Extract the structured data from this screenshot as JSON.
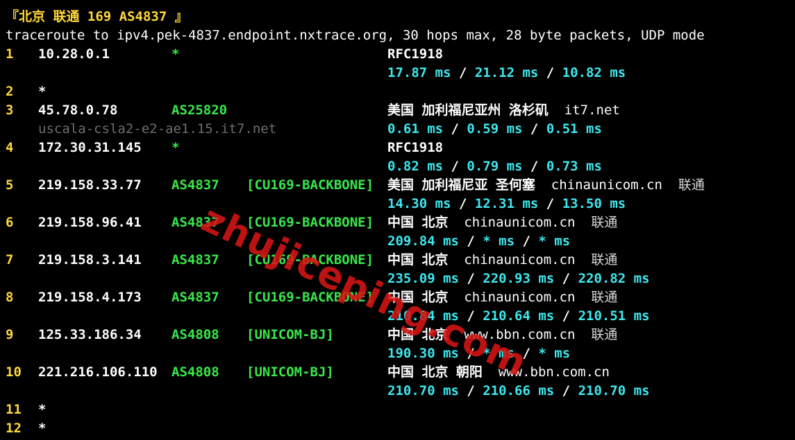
{
  "header": "『北京 联通 169 AS4837 』",
  "command": "traceroute to ipv4.pek-4837.endpoint.nxtrace.org, 30 hops max, 28 byte packets, UDP mode",
  "hops": [
    {
      "hop": "1",
      "ip": "10.28.0.1",
      "asn": "*",
      "tag": "",
      "geo": "RFC1918",
      "domain": "",
      "isp": "",
      "rtt": [
        "17.87 ms",
        "21.12 ms",
        "10.82 ms"
      ],
      "rdns": ""
    },
    {
      "hop": "2",
      "ip": "*",
      "asn": "",
      "tag": "",
      "geo": "",
      "domain": "",
      "isp": "",
      "rtt": [],
      "rdns": ""
    },
    {
      "hop": "3",
      "ip": "45.78.0.78",
      "asn": "AS25820",
      "tag": "",
      "geo": "美国 加利福尼亚州 洛杉矶",
      "domain": "it7.net",
      "isp": "",
      "rtt": [
        "0.61 ms",
        "0.59 ms",
        "0.51 ms"
      ],
      "rdns": "uscala-csla2-e2-ae1.15.it7.net"
    },
    {
      "hop": "4",
      "ip": "172.30.31.145",
      "asn": "*",
      "tag": "",
      "geo": "RFC1918",
      "domain": "",
      "isp": "",
      "rtt": [
        "0.82 ms",
        "0.79 ms",
        "0.73 ms"
      ],
      "rdns": ""
    },
    {
      "hop": "5",
      "ip": "219.158.33.77",
      "asn": "AS4837",
      "tag": "[CU169-BACKBONE]",
      "geo": "美国 加利福尼亚 圣何塞",
      "domain": "chinaunicom.cn",
      "isp": "联通",
      "rtt": [
        "14.30 ms",
        "12.31 ms",
        "13.50 ms"
      ],
      "rdns": ""
    },
    {
      "hop": "6",
      "ip": "219.158.96.41",
      "asn": "AS4837",
      "tag": "[CU169-BACKBONE]",
      "geo": "中国 北京",
      "domain": "chinaunicom.cn",
      "isp": "联通",
      "rtt": [
        "209.84 ms",
        "* ms",
        "* ms"
      ],
      "rdns": ""
    },
    {
      "hop": "7",
      "ip": "219.158.3.141",
      "asn": "AS4837",
      "tag": "[CU169-BACKBONE]",
      "geo": "中国 北京",
      "domain": "chinaunicom.cn",
      "isp": "联通",
      "rtt": [
        "235.09 ms",
        "220.93 ms",
        "220.82 ms"
      ],
      "rdns": ""
    },
    {
      "hop": "8",
      "ip": "219.158.4.173",
      "asn": "AS4837",
      "tag": "[CU169-BACKBONE]",
      "geo": "中国 北京",
      "domain": "chinaunicom.cn",
      "isp": "联通",
      "rtt": [
        "210.84 ms",
        "210.64 ms",
        "210.51 ms"
      ],
      "rdns": ""
    },
    {
      "hop": "9",
      "ip": "125.33.186.34",
      "asn": "AS4808",
      "tag": "[UNICOM-BJ]",
      "geo": "中国 北京",
      "domain": "www.bbn.com.cn",
      "isp": "联通",
      "rtt": [
        "190.30 ms",
        "* ms",
        "* ms"
      ],
      "rdns": ""
    },
    {
      "hop": "10",
      "ip": "221.216.106.110",
      "asn": "AS4808",
      "tag": "[UNICOM-BJ]",
      "geo": "中国 北京 朝阳",
      "domain": "www.bbn.com.cn",
      "isp": "",
      "rtt": [
        "210.70 ms",
        "210.66 ms",
        "210.70 ms"
      ],
      "rdns": ""
    },
    {
      "hop": "11",
      "ip": "*",
      "asn": "",
      "tag": "",
      "geo": "",
      "domain": "",
      "isp": "",
      "rtt": [],
      "rdns": ""
    },
    {
      "hop": "12",
      "ip": "*",
      "asn": "",
      "tag": "",
      "geo": "",
      "domain": "",
      "isp": "",
      "rtt": [],
      "rdns": ""
    }
  ],
  "watermark": "zhujiceping.com",
  "colors": {
    "background": "#000000",
    "hop_number": "#ffd83a",
    "asn": "#38e84a",
    "rtt": "#3ee8ef",
    "rdns": "#6e6e6e",
    "watermark": "#d71414"
  }
}
